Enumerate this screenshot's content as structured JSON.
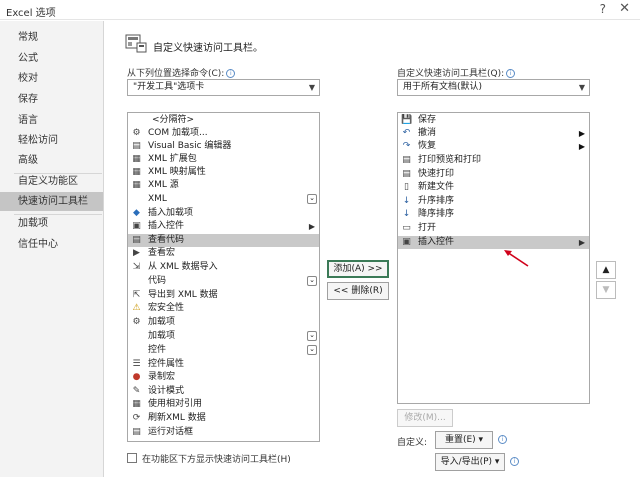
{
  "window": {
    "title": "Excel 选项",
    "help": "?",
    "close": "✕"
  },
  "sidebar": {
    "items": [
      {
        "label": "常规"
      },
      {
        "label": "公式"
      },
      {
        "label": "校对"
      },
      {
        "label": "保存"
      },
      {
        "label": "语言"
      },
      {
        "label": "轻松访问"
      },
      {
        "label": "高级"
      },
      {
        "label": "自定义功能区"
      },
      {
        "label": "快速访问工具栏"
      },
      {
        "label": "加载项"
      },
      {
        "label": "信任中心"
      }
    ],
    "active_index": 8
  },
  "header": {
    "title": "自定义快速访问工具栏。"
  },
  "left": {
    "choose_label": "从下列位置选择命令(C):",
    "choose_value": "\"开发工具\"选项卡",
    "commands": [
      {
        "label": "<分隔符>",
        "icon": ""
      },
      {
        "label": "COM 加载项...",
        "icon": "⚙"
      },
      {
        "label": "Visual Basic 编辑器",
        "icon": "▤"
      },
      {
        "label": "XML 扩展包",
        "icon": "▦"
      },
      {
        "label": "XML 映射属性",
        "icon": "▦"
      },
      {
        "label": "XML 源",
        "icon": "▦"
      },
      {
        "label": "XML",
        "icon": ""
      },
      {
        "label": "插入加载项",
        "icon": "◆"
      },
      {
        "label": "插入控件",
        "icon": "▣"
      },
      {
        "label": "查看代码",
        "icon": "▤"
      },
      {
        "label": "查看宏",
        "icon": "▶"
      },
      {
        "label": "从 XML 数据导入",
        "icon": "⇲"
      },
      {
        "label": "代码",
        "icon": ""
      },
      {
        "label": "导出到 XML 数据",
        "icon": "⇱"
      },
      {
        "label": "宏安全性",
        "icon": "⚠"
      },
      {
        "label": "加载项",
        "icon": "⚙"
      },
      {
        "label": "加载项",
        "icon": ""
      },
      {
        "label": "控件",
        "icon": ""
      },
      {
        "label": "控件属性",
        "icon": "☰"
      },
      {
        "label": "录制宏",
        "icon": "●"
      },
      {
        "label": "设计模式",
        "icon": "✎"
      },
      {
        "label": "使用相对引用",
        "icon": "▦"
      },
      {
        "label": "刷新XML 数据",
        "icon": "⟳"
      },
      {
        "label": "运行对话框",
        "icon": "▤"
      }
    ],
    "show_below_label": "在功能区下方显示快速访问工具栏(H)"
  },
  "middle": {
    "add_label": "添加(A) >>",
    "remove_label": "<< 删除(R)"
  },
  "right": {
    "customize_label": "自定义快速访问工具栏(Q):",
    "customize_value": "用于所有文档(默认)",
    "commands": [
      {
        "label": "保存",
        "icon": "💾"
      },
      {
        "label": "撤消",
        "icon": "↶"
      },
      {
        "label": "恢复",
        "icon": "↷"
      },
      {
        "label": "打印预览和打印",
        "icon": "▤"
      },
      {
        "label": "快速打印",
        "icon": "▤"
      },
      {
        "label": "新建文件",
        "icon": "▯"
      },
      {
        "label": "升序排序",
        "icon": "↓"
      },
      {
        "label": "降序排序",
        "icon": "↓"
      },
      {
        "label": "打开",
        "icon": "▭"
      },
      {
        "label": "插入控件",
        "icon": "▣"
      }
    ],
    "modify_label": "修改(M)...",
    "customizations_label": "自定义:",
    "reset_label": "重置(E) ▾",
    "import_export_label": "导入/导出(P) ▾",
    "move_up": "▲",
    "move_down": "▼"
  }
}
